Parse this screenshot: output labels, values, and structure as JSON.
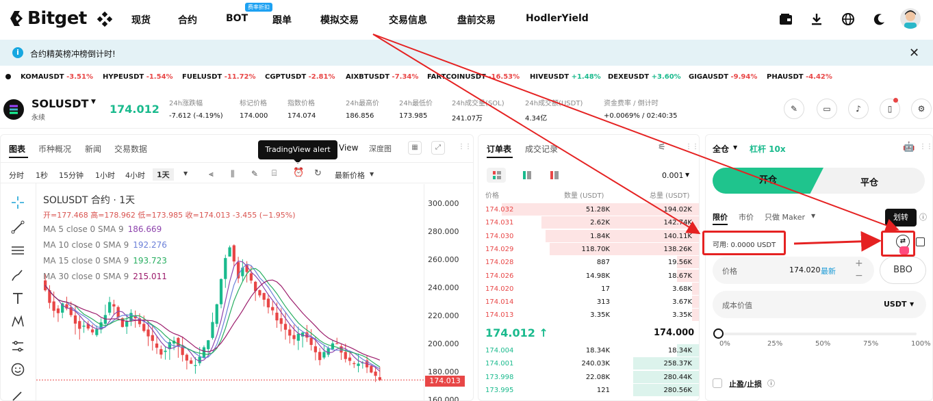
{
  "nav": {
    "brand": "Bitget",
    "items": [
      "现货",
      "合约",
      "BOT",
      "跟单",
      "模拟交易",
      "交易信息",
      "盘前交易",
      "HodlerYield"
    ],
    "bot_badge": "费率折扣"
  },
  "banner": {
    "text": "合约精英榜冲榜倒计时!",
    "close": "✕"
  },
  "ticker": [
    {
      "sym": "KOMAUSDT",
      "chg": "-3.51%",
      "dir": "neg"
    },
    {
      "sym": "HYPEUSDT",
      "chg": "-1.54%",
      "dir": "neg"
    },
    {
      "sym": "FUELUSDT",
      "chg": "-11.72%",
      "dir": "neg"
    },
    {
      "sym": "CGPTUSDT",
      "chg": "-2.81%",
      "dir": "neg"
    },
    {
      "sym": "AIXBTUSDT",
      "chg": "-7.34%",
      "dir": "neg"
    },
    {
      "sym": "FARTCOINUSDT",
      "chg": "-16.53%",
      "dir": "neg"
    },
    {
      "sym": "HIVEUSDT",
      "chg": "+1.48%",
      "dir": "pos"
    },
    {
      "sym": "DEXEUSDT",
      "chg": "+3.60%",
      "dir": "pos"
    },
    {
      "sym": "GIGAUSDT",
      "chg": "-9.94%",
      "dir": "neg"
    },
    {
      "sym": "PHAUSDT",
      "chg": "-4.42%",
      "dir": "neg"
    }
  ],
  "symbol": {
    "name": "SOLUSDT",
    "sub": "永续",
    "price": "174.012",
    "stats": [
      {
        "label": "24h涨跌幅",
        "value": "-7.612 (-4.19%)",
        "dir": "neg"
      },
      {
        "label": "标记价格",
        "value": "174.000",
        "dir": ""
      },
      {
        "label": "指数价格",
        "value": "174.074",
        "dir": ""
      },
      {
        "label": "24h最高价",
        "value": "186.856",
        "dir": ""
      },
      {
        "label": "24h最低价",
        "value": "173.985",
        "dir": ""
      },
      {
        "label": "24h成交量(SOL)",
        "value": "241.07万",
        "dir": ""
      },
      {
        "label": "24h成交额(USDT)",
        "value": "4.34亿",
        "dir": ""
      },
      {
        "label": "资金费率 / 倒计时",
        "value": "+0.0069% / 02:40:35",
        "dir": "pos"
      }
    ]
  },
  "chart": {
    "tabs": [
      "图表",
      "币种概况",
      "新闻",
      "交易数据"
    ],
    "view_tabs": [
      "View",
      "深度图"
    ],
    "tooltip": "TradingView alert",
    "timeframes": [
      "分时",
      "1秒",
      "15分钟",
      "1小时",
      "4小时",
      "1天"
    ],
    "price_mode": "最新价格",
    "title": "SOLUSDT 合约 · 1天",
    "ohlc": "开=177.468  高=178.962  低=173.985  收=174.013  -3.455 (−1.95%)",
    "ma": [
      {
        "label": "MA 5 close 0 SMA 9",
        "value": "186.669",
        "color": "#8e44ad"
      },
      {
        "label": "MA 10 close 0 SMA 9",
        "value": "192.276",
        "color": "#6a7fd8"
      },
      {
        "label": "MA 15 close 0 SMA 9",
        "value": "193.723",
        "color": "#27ae60"
      },
      {
        "label": "MA 30 close 0 SMA 9",
        "value": "215.011",
        "color": "#9b1b6b"
      }
    ],
    "y_ticks": [
      "300.000",
      "280.000",
      "260.000",
      "240.000",
      "220.000",
      "200.000",
      "180.000",
      "160.000"
    ],
    "last_price": "174.013"
  },
  "orderbook": {
    "tabs": [
      "订单表",
      "成交记录"
    ],
    "precision": "0.001",
    "headers": [
      "价格",
      "数量 (USDT)",
      "总量 (USDT)"
    ],
    "asks": [
      {
        "p": "174.032",
        "q": "51.28K",
        "t": "194.02K",
        "w": 0.9
      },
      {
        "p": "174.031",
        "q": "2.62K",
        "t": "142.74K",
        "w": 0.72
      },
      {
        "p": "174.030",
        "q": "1.84K",
        "t": "140.11K",
        "w": 0.7
      },
      {
        "p": "174.029",
        "q": "118.70K",
        "t": "138.26K",
        "w": 0.68
      },
      {
        "p": "174.028",
        "q": "887",
        "t": "19.56K",
        "w": 0.1
      },
      {
        "p": "174.026",
        "q": "14.98K",
        "t": "18.67K",
        "w": 0.1
      },
      {
        "p": "174.020",
        "q": "17",
        "t": "3.68K",
        "w": 0.03
      },
      {
        "p": "174.014",
        "q": "313",
        "t": "3.67K",
        "w": 0.03
      },
      {
        "p": "174.013",
        "q": "3.35K",
        "t": "3.35K",
        "w": 0.03
      }
    ],
    "mid": {
      "price": "174.012 ↑",
      "mark": "174.000"
    },
    "bids": [
      {
        "p": "174.004",
        "q": "18.34K",
        "t": "18.34K",
        "w": 0.1
      },
      {
        "p": "174.001",
        "q": "240.03K",
        "t": "258.37K",
        "w": 0.3
      },
      {
        "p": "173.998",
        "q": "22.08K",
        "t": "280.44K",
        "w": 0.3
      },
      {
        "p": "173.995",
        "q": "121",
        "t": "280.56K",
        "w": 0.3
      }
    ]
  },
  "trade": {
    "margin_mode": "全仓",
    "leverage": "杠杆 10x",
    "open": "开仓",
    "close": "平仓",
    "order_types": [
      "限价",
      "市价",
      "只做 Maker"
    ],
    "available": "可用: 0.0000 USDT",
    "transfer_tooltip": "划转",
    "price_label": "价格",
    "price_value": "174.020",
    "price_latest": "最新",
    "bbo": "BBO",
    "cost_label": "成本价值",
    "cost_unit": "USDT",
    "slider_marks": [
      "0%",
      "25%",
      "50%",
      "75%",
      "100%"
    ],
    "tpsl": "止盈/止损"
  }
}
